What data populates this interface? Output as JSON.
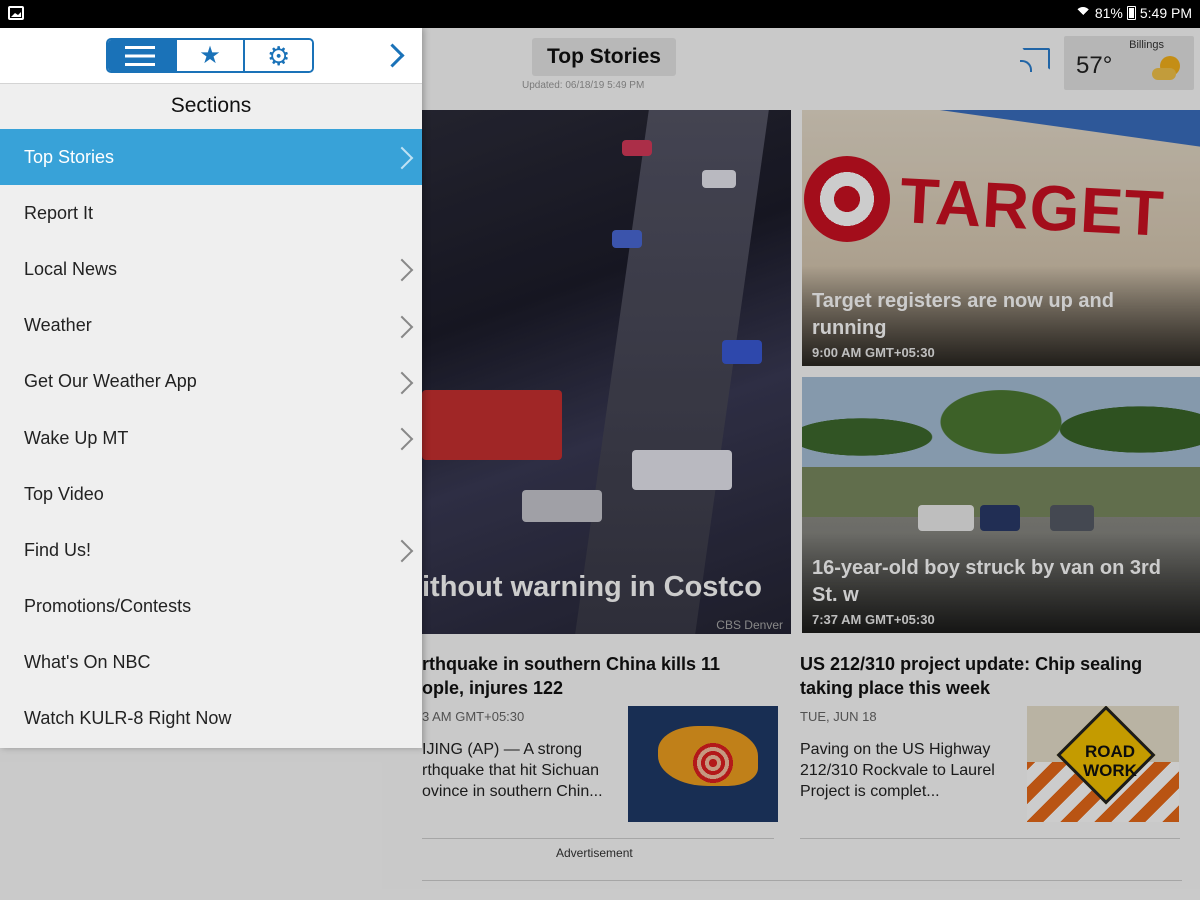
{
  "status_bar": {
    "battery": "81%",
    "time": "5:49 PM"
  },
  "header": {
    "title": "Top Stories",
    "updated": "Updated: 06/18/19 5:49 PM",
    "weather": {
      "city": "Billings",
      "temp": "57°"
    }
  },
  "featured": {
    "caption": "ithout warning in Costco",
    "credit": "CBS Denver"
  },
  "cards": [
    {
      "brand": "TARGET",
      "caption": "Target registers are now up and running",
      "time": "9:00 AM GMT+05:30"
    },
    {
      "caption": "16-year-old boy struck by van on 3rd St. w",
      "time": "7:37 AM GMT+05:30"
    }
  ],
  "stories": [
    {
      "headline": "rthquake in southern China kills 11 ople, injures 122",
      "date": "3 AM GMT+05:30",
      "summary": "IJING (AP) — A strong rthquake that hit Sichuan ovince in southern Chin..."
    },
    {
      "headline": "US 212/310 project update: Chip sealing taking place this week",
      "date": "TUE, JUN 18",
      "summary": "Paving on the US Highway 212/310 Rockvale to Laurel Project is complet...",
      "thumb_text": "ROAD WORK"
    }
  ],
  "advertisement": "Advertisement",
  "drawer": {
    "heading": "Sections",
    "items": [
      {
        "label": "Top Stories"
      },
      {
        "label": "Report It"
      },
      {
        "label": "Local News"
      },
      {
        "label": "Weather"
      },
      {
        "label": "Get Our Weather App"
      },
      {
        "label": "Wake Up MT"
      },
      {
        "label": "Top Video"
      },
      {
        "label": "Find Us!"
      },
      {
        "label": "Promotions/Contests"
      },
      {
        "label": "What's On NBC"
      },
      {
        "label": "Watch KULR-8 Right Now"
      }
    ]
  },
  "colors": {
    "accent": "#1a72b8",
    "selected": "#38a2d8",
    "target_red": "#cc1122"
  },
  "icons": {
    "segments": [
      "list-icon",
      "star-icon",
      "gear-icon"
    ],
    "forward": "chevron-right-icon",
    "cast": "cast-icon",
    "weather": "sun-cloud-icon"
  }
}
